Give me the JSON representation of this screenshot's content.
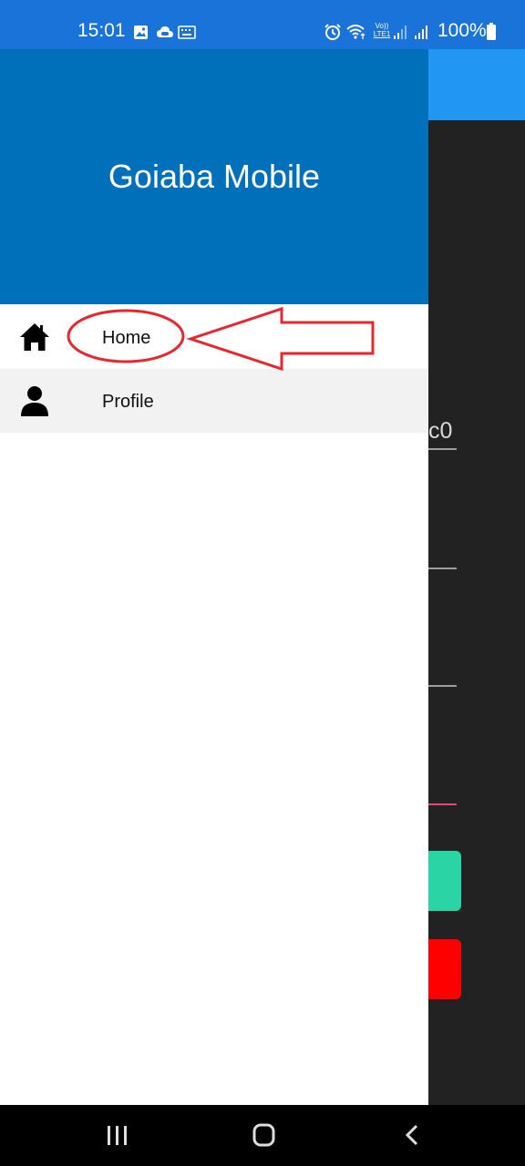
{
  "status_bar": {
    "time": "15:01",
    "battery": "100%",
    "left_icons": [
      "image-icon",
      "cloud-game-icon",
      "keyboard-icon"
    ],
    "right_icons": [
      "alarm-icon",
      "wifi-icon",
      "volte-icon",
      "signal-icon",
      "signal-icon",
      "battery-icon"
    ],
    "volte_text_top": "Vo))",
    "volte_text_bottom": "LTE1"
  },
  "drawer": {
    "title": "Goiaba Mobile",
    "header_color": "#0070bb",
    "items": [
      {
        "label": "Home",
        "icon": "home-icon"
      },
      {
        "label": "Profile",
        "icon": "person-icon"
      }
    ]
  },
  "background_app": {
    "toolbar_color": "#2196f3",
    "partial_text": "c0",
    "button_colors": [
      "#2bd4a4",
      "#ff0000"
    ]
  },
  "annotation": {
    "color": "#e8262e",
    "target": "Home"
  },
  "system_nav": {
    "buttons": [
      "recent-apps",
      "home",
      "back"
    ]
  }
}
